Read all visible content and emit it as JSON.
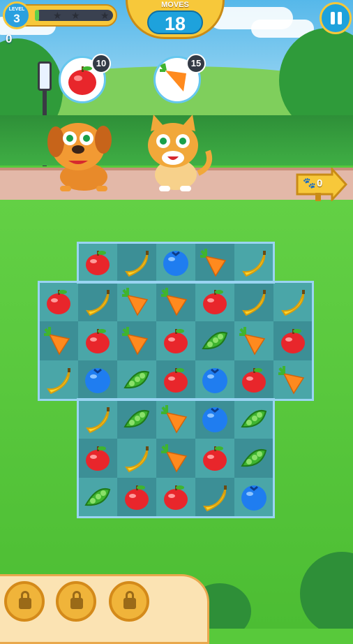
{
  "hud": {
    "level_word": "LEVEL",
    "level_number": "3",
    "progress_fraction": 0.05,
    "stars_earned": 0,
    "stars_total": 3,
    "score": "0",
    "moves_label": "MOVES",
    "moves_value": "18"
  },
  "goals": [
    {
      "item": "apple",
      "count": "10"
    },
    {
      "item": "carrot",
      "count": "15"
    }
  ],
  "collect_sign": {
    "icon": "paw-icon",
    "count": "0"
  },
  "board": {
    "rows": [
      [
        null,
        "apple",
        "banana",
        "blueberry",
        "carrot",
        "banana",
        null
      ],
      [
        "apple",
        "banana",
        "carrot",
        "carrot",
        "apple",
        "banana",
        "banana"
      ],
      [
        "carrot",
        "apple",
        "carrot",
        "apple",
        "pea",
        "carrot",
        "apple"
      ],
      [
        "banana",
        "blueberry",
        "pea",
        "apple",
        "blueberry",
        "apple",
        "carrot"
      ],
      [
        null,
        "banana",
        "pea",
        "carrot",
        "blueberry",
        "pea",
        null
      ],
      [
        null,
        "apple",
        "banana",
        "carrot",
        "apple",
        "pea",
        null
      ],
      [
        null,
        "pea",
        "apple",
        "apple",
        "banana",
        "blueberry",
        null
      ]
    ]
  },
  "boosters": [
    {
      "state": "locked"
    },
    {
      "state": "locked"
    },
    {
      "state": "locked"
    }
  ],
  "colors": {
    "apple": "#e8262b",
    "banana": "#ffd42a",
    "blueberry": "#1f7df0",
    "carrot": "#ff8a1e",
    "pea": "#3fb42f",
    "accent_yellow": "#f7c83a",
    "accent_blue": "#1ea2dc"
  }
}
